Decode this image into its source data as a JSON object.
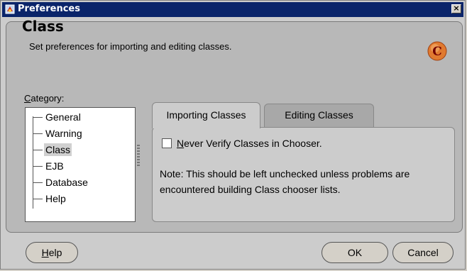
{
  "window": {
    "title": "Preferences",
    "close_label": "×"
  },
  "header": {
    "title": "Class",
    "subtitle": "Set preferences for importing and editing classes.",
    "icon_letter": "C"
  },
  "category": {
    "label_mnemonic": "C",
    "label_rest": "ategory:",
    "items": [
      {
        "label": "General"
      },
      {
        "label": "Warning"
      },
      {
        "label": "Class",
        "selected": true
      },
      {
        "label": "EJB"
      },
      {
        "label": "Database"
      },
      {
        "label": "Help"
      }
    ]
  },
  "tabs": [
    {
      "label": "Importing Classes",
      "active": true
    },
    {
      "label": "Editing Classes",
      "active": false
    }
  ],
  "options": {
    "checkbox_mnemonic": "N",
    "checkbox_rest": "ever Verify Classes in Chooser.",
    "checkbox_checked": false,
    "note": "Note: This should be left unchecked unless problems are encountered building Class chooser lists."
  },
  "buttons": {
    "help_mnemonic": "H",
    "help_rest": "elp",
    "ok": "OK",
    "cancel": "Cancel"
  }
}
